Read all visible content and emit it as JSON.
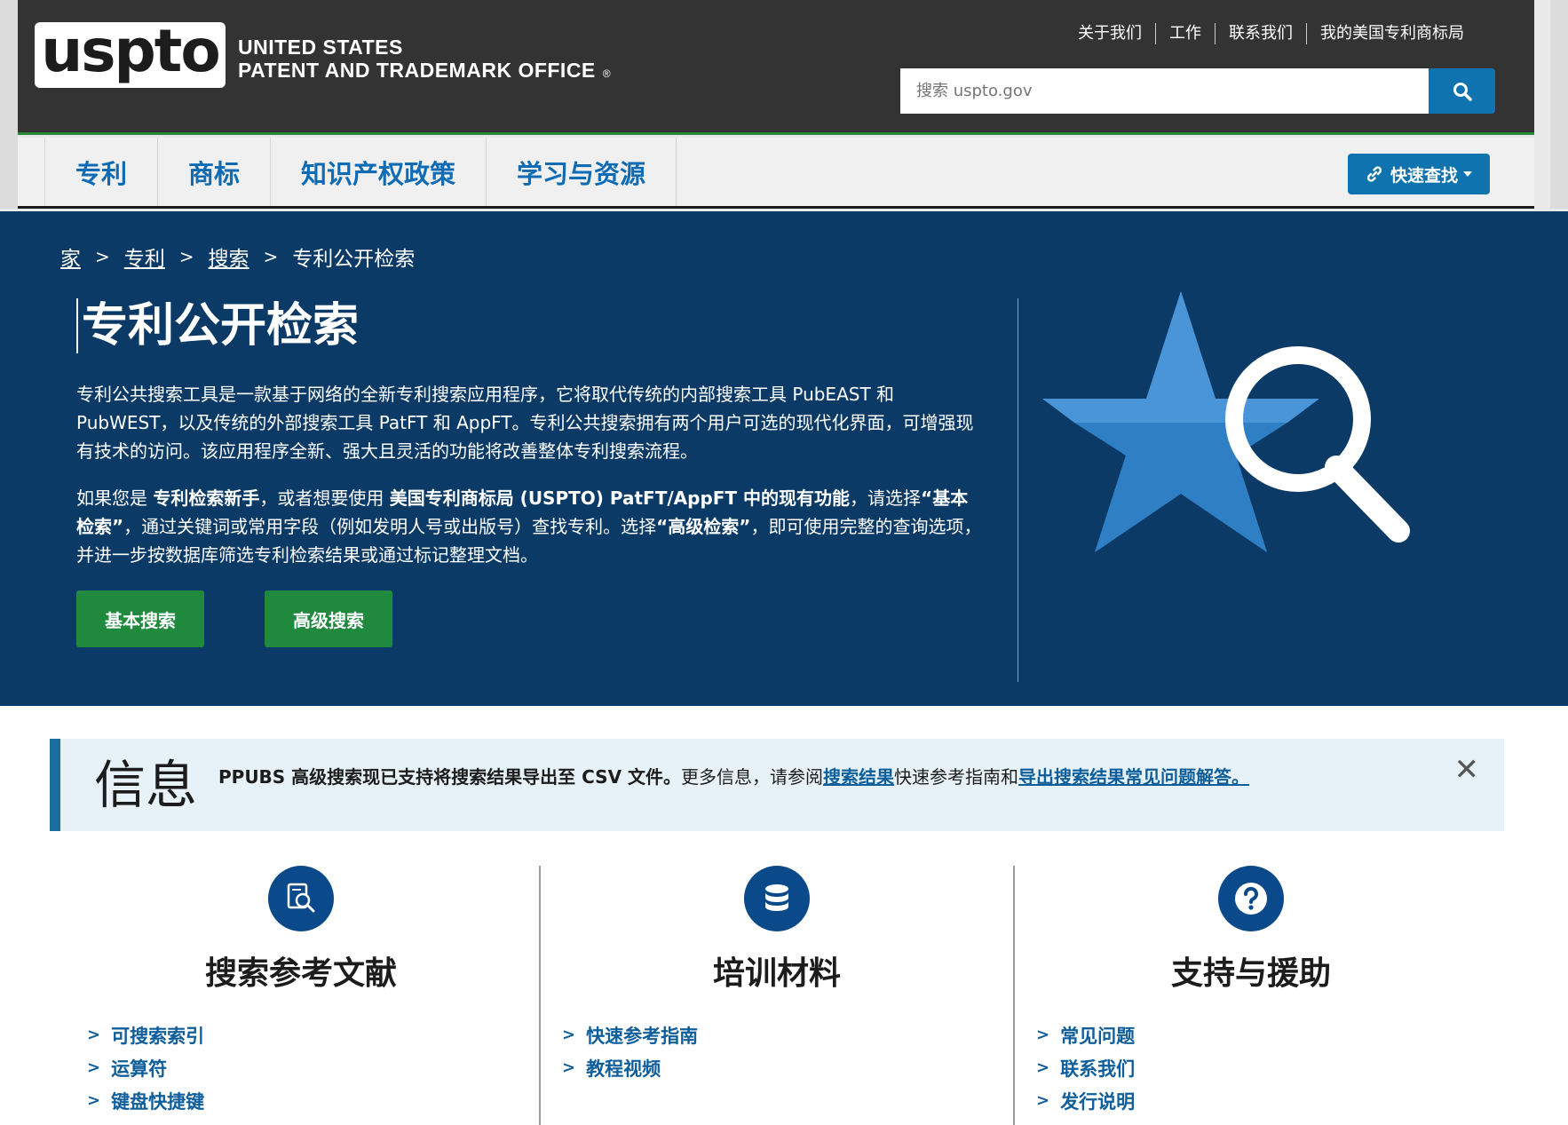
{
  "header": {
    "logo_text": "uspto",
    "org_line1": "UNITED STATES",
    "org_line2": "PATENT AND TRADEMARK OFFICE",
    "reg_mark": "®",
    "util_nav": [
      "关于我们",
      "工作",
      "联系我们",
      "我的美国专利商标局"
    ],
    "search_placeholder": "搜索 uspto.gov"
  },
  "nav": {
    "items": [
      "专利",
      "商标",
      "知识产权政策",
      "学习与资源"
    ],
    "quick_find": "快速查找"
  },
  "breadcrumb": {
    "items": [
      "家",
      "专利",
      "搜索",
      "专利公开检索"
    ],
    "separator": ">"
  },
  "hero": {
    "title": "专利公开检索",
    "p1": "专利公共搜索工具是一款基于网络的全新专利搜索应用程序，它将取代传统的内部搜索工具 PubEAST 和 PubWEST，以及传统的外部搜索工具 PatFT 和 AppFT。专利公共搜索拥有两个用户可选的现代化界面，可增强现有技术的访问。该应用程序全新、强大且灵活的功能将改善整体专利搜索流程。",
    "p2_a": "如果您是 ",
    "p2_b": "专利检索新手",
    "p2_c": "，或者想要使用 ",
    "p2_d": "美国专利商标局 (USPTO) PatFT/AppFT 中的现有功能",
    "p2_e": "，请选择",
    "p2_f": "“基本检索”",
    "p2_g": "，通过关键词或常用字段（例如发明人号或出版号）查找专利。选择",
    "p2_h": "“高级检索”",
    "p2_i": "，即可使用完整的查询选项，并进一步按数据库筛选专利检索结果或通过标记整理文档。",
    "btn_basic": "基本搜索",
    "btn_advanced": "高级搜索"
  },
  "info": {
    "title": "信息",
    "text_bold": "PPUBS 高级搜索现已支持将搜索结果导出至 CSV 文件。",
    "text_1": "更多信息，请参阅",
    "link_1": "搜索结果",
    "text_2": "快速参考指南和",
    "link_2": "导出搜索结果常见问题解答。",
    "close": "✕"
  },
  "columns": [
    {
      "title": "搜索参考文献",
      "icon": "search-document-icon",
      "links": [
        "可搜索索引",
        "运算符",
        "键盘快捷键"
      ]
    },
    {
      "title": "培训材料",
      "icon": "database-icon",
      "links": [
        "快速参考指南",
        "教程视频"
      ]
    },
    {
      "title": "支持与援助",
      "icon": "question-icon",
      "links": [
        "常见问题",
        "联系我们",
        "发行说明"
      ]
    }
  ],
  "colors": {
    "header_bg": "#333333",
    "primary_blue": "#0f73b0",
    "hero_bg": "#0b3a66",
    "green_button": "#1f8a3e",
    "info_bg": "#e6f2f7"
  }
}
